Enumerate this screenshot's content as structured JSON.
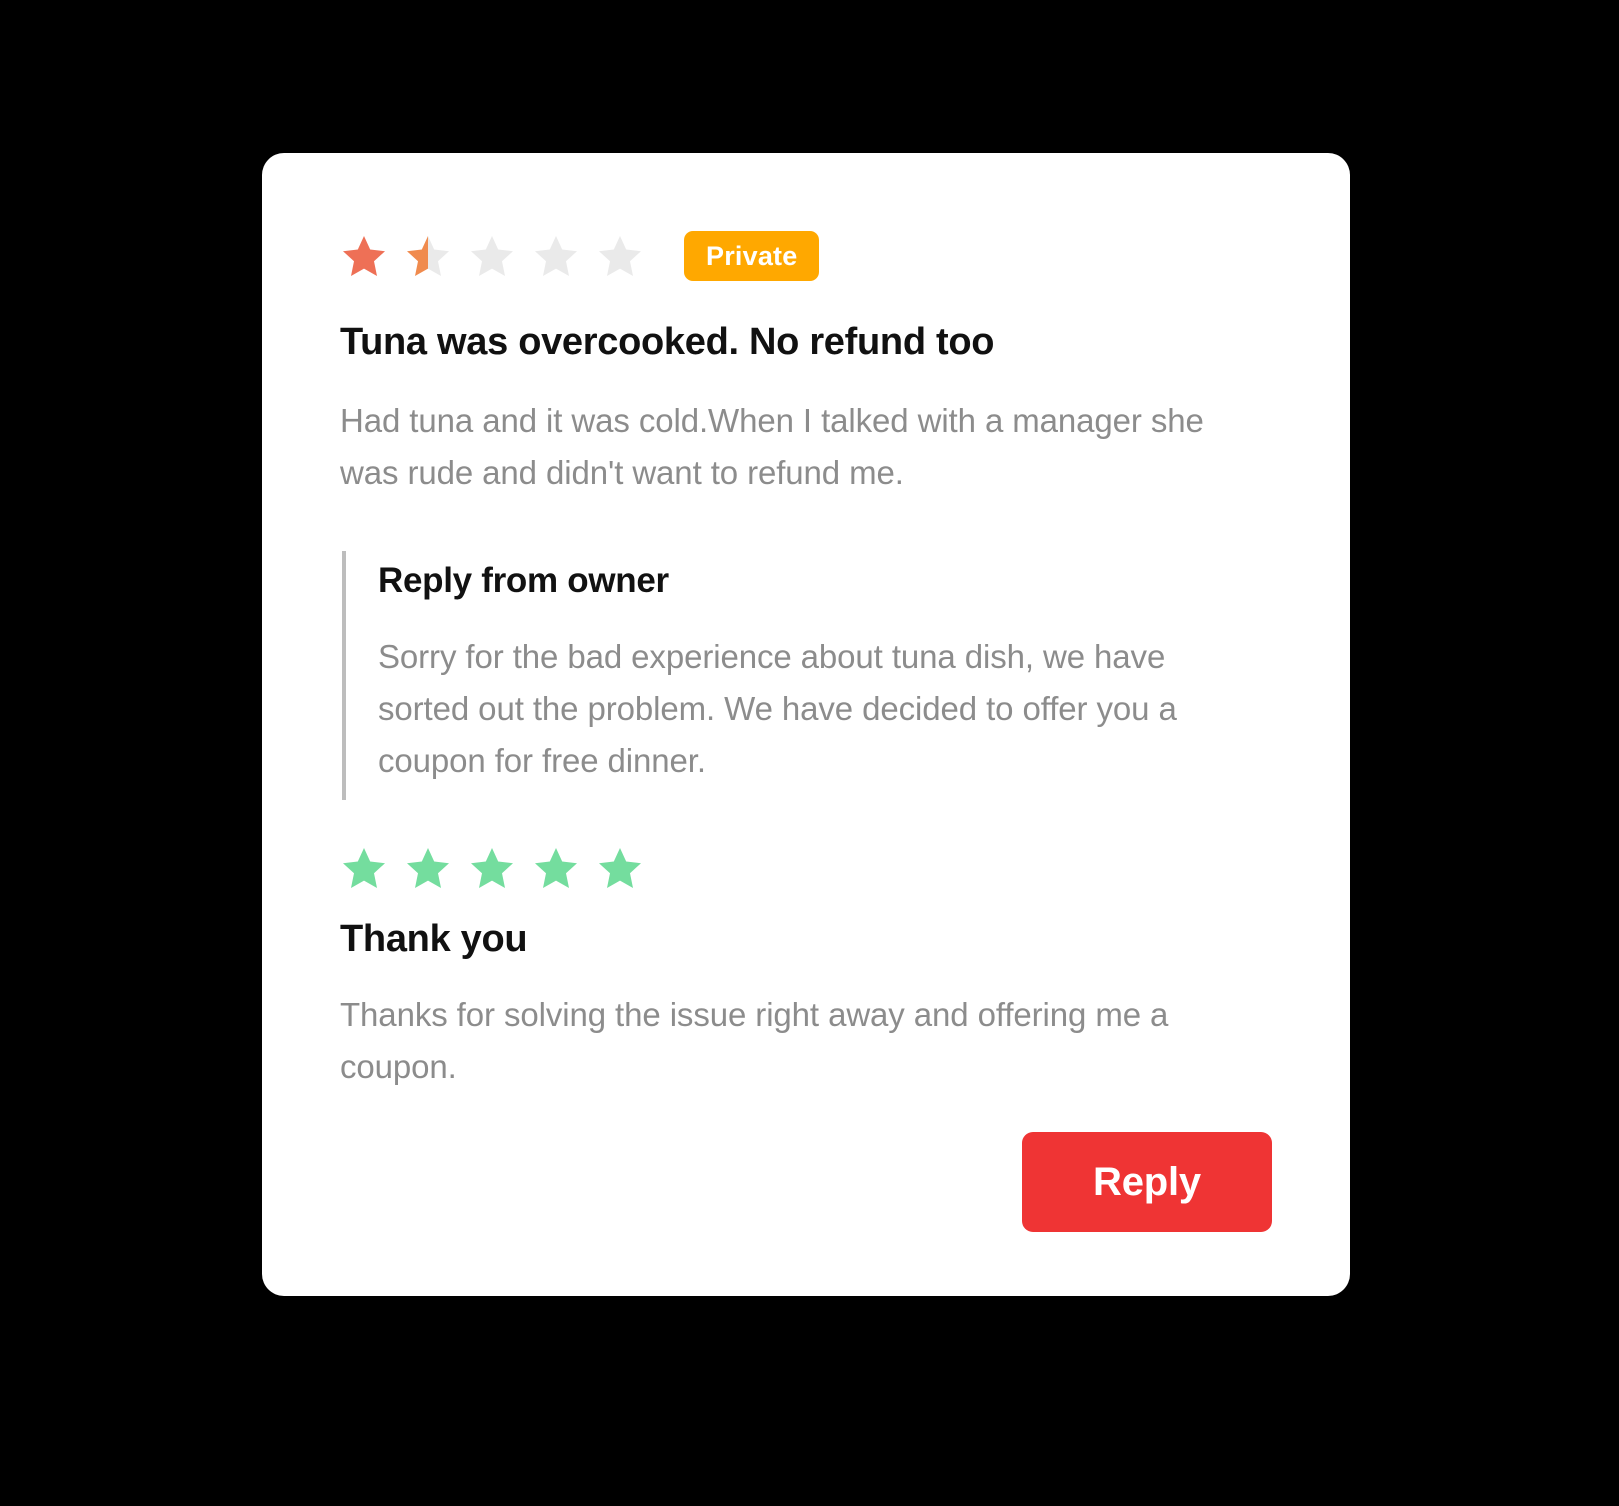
{
  "card": {
    "rating": {
      "value": 1.5,
      "max": 5,
      "full_color": "#EE7056",
      "half_color": "#F08B4E",
      "empty_color": "#EAEAEA",
      "icon": "star-icon"
    },
    "badge": {
      "label": "Private",
      "color": "#FFA800",
      "text_color": "#FFFFFF"
    },
    "title": "Tuna was overcooked. No refund too",
    "body": "Had tuna and it was cold.When I talked with a manager she was rude and didn't want to refund me.",
    "owner_reply": {
      "title": "Reply from owner",
      "body": "Sorry for the bad experience about tuna dish, we have sorted out the problem. We have decided to offer you a coupon for free dinner.",
      "accent_color": "#BDBDBD"
    },
    "followup": {
      "rating": {
        "value": 5,
        "max": 5,
        "full_color": "#74DD9E",
        "icon": "star-icon"
      },
      "title": "Thank you",
      "body": "Thanks for solving the issue right away and offering me a coupon."
    },
    "actions": {
      "reply_label": "Reply",
      "reply_color": "#EF3434"
    },
    "background_color": "#FFFFFF",
    "page_background_color": "#000000",
    "body_text_color": "#8C8C8C",
    "heading_text_color": "#111111"
  }
}
